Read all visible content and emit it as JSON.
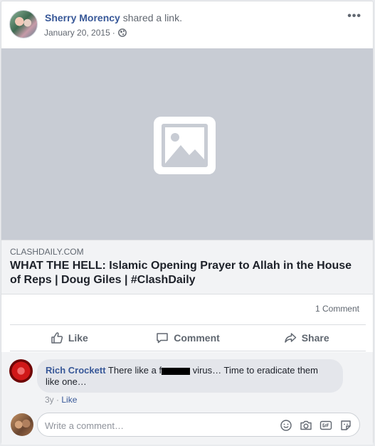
{
  "post": {
    "author": "Sherry Morency",
    "action": "shared a link.",
    "date": "January 20, 2015",
    "date_separator": "·",
    "more_menu": "•••",
    "privacy_icon": "globe-icon"
  },
  "link": {
    "image_icon": "image-placeholder-icon",
    "domain": "CLASHDAILY.COM",
    "title": "WHAT THE HELL: Islamic Opening Prayer to Allah in the House of Reps | Doug Giles | #ClashDaily"
  },
  "counts": {
    "comments": "1 Comment"
  },
  "actions": {
    "like": "Like",
    "comment": "Comment",
    "share": "Share"
  },
  "comment": {
    "name": "Rich Crockett",
    "text_before": "There like a f",
    "text_after": " virus… Time to eradicate them like one…",
    "age": "3y",
    "separator": "·",
    "like": "Like"
  },
  "composer": {
    "placeholder": "Write a comment…",
    "icons": [
      "emoji-icon",
      "camera-icon",
      "gif-icon",
      "sticker-icon"
    ]
  },
  "colors": {
    "link_blue": "#385898",
    "placeholder_gray": "#c8ccd4",
    "background": "#e9ebee"
  }
}
